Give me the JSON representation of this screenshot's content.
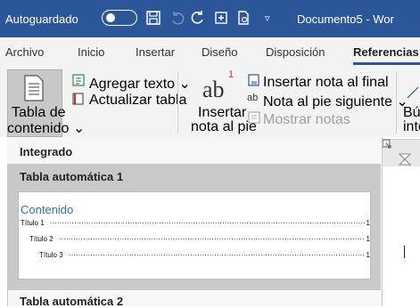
{
  "titlebar": {
    "autosave_label": "Autoguardado",
    "autosave_state": "●",
    "document_title": "Documento5 - Wor"
  },
  "tabs": [
    {
      "label": "Archivo"
    },
    {
      "label": "Inicio"
    },
    {
      "label": "Insertar"
    },
    {
      "label": "Diseño"
    },
    {
      "label": "Disposición"
    },
    {
      "label": "Referencias",
      "active": true
    }
  ],
  "ribbon": {
    "toc_button": {
      "line1": "Tabla de",
      "line2": "contenido ⌄"
    },
    "add_text": "Agregar texto ⌄",
    "update_table": "Actualizar tabla",
    "insert_footnote": {
      "line1": "Insertar",
      "line2": "nota al pie"
    },
    "footnote_glyph": "ab",
    "footnote_sup": "1",
    "insert_endnote": "Insertar nota al final",
    "next_footnote": "Nota al pie siguiente  ⌄",
    "show_notes": "Mostrar notas",
    "search": {
      "line1": "Bús",
      "line2": "inte"
    }
  },
  "dropdown": {
    "section_header": "Integrado",
    "selected_item": {
      "title": "Tabla automática 1",
      "preview": {
        "heading": "Contenido",
        "entries": [
          {
            "label": "Título 1",
            "page": "1"
          },
          {
            "label": "Título 2",
            "page": "1"
          },
          {
            "label": "Título 3",
            "page": "1"
          }
        ]
      }
    },
    "next_item": {
      "title": "Tabla automática 2"
    }
  },
  "colors": {
    "titlebar": "#2b579a",
    "toc_heading": "#2e74b5",
    "selected_bg": "#c9c9c9"
  }
}
